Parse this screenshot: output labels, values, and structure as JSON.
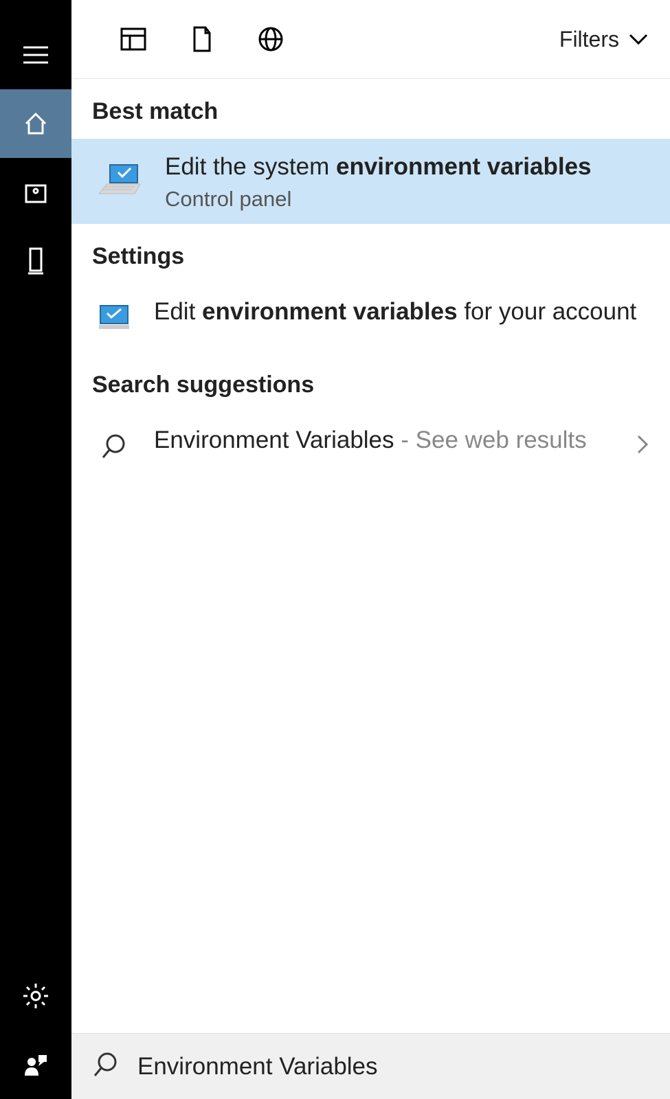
{
  "topbar": {
    "filters_label": "Filters"
  },
  "sections": {
    "best_match": "Best match",
    "settings": "Settings",
    "suggestions": "Search suggestions"
  },
  "best": {
    "title_prefix": "Edit the system ",
    "title_bold": "environment variables",
    "subtitle": "Control panel"
  },
  "settings_result": {
    "prefix": "Edit ",
    "bold": "environment variables",
    "suffix": " for your account"
  },
  "suggestion": {
    "query": "Environment Variables",
    "hint": " - See web results"
  },
  "search": {
    "value": "Environment Variables"
  }
}
